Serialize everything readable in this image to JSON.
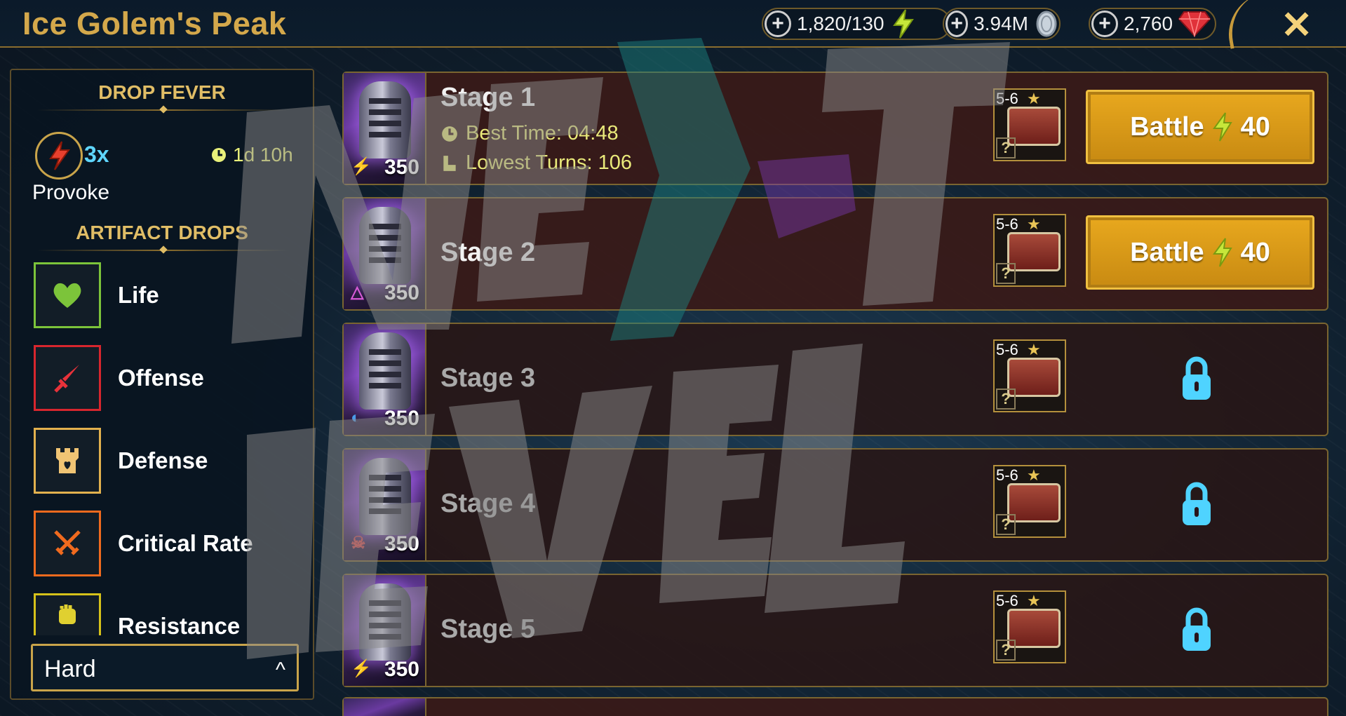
{
  "header": {
    "title": "Ice Golem's Peak",
    "energy": "1,820/130",
    "silver": "3.94M",
    "gems": "2,760"
  },
  "drop_fever": {
    "heading": "DROP FEVER",
    "multiplier": "3x",
    "timer": "1d 10h",
    "set_name": "Provoke"
  },
  "artifact_drops": {
    "heading": "ARTIFACT DROPS",
    "items": [
      {
        "label": "Life",
        "icon": "heart-icon",
        "color": "#7cc43a"
      },
      {
        "label": "Offense",
        "icon": "sword-icon",
        "color": "#d8262e"
      },
      {
        "label": "Defense",
        "icon": "tower-icon",
        "color": "#e2b14e"
      },
      {
        "label": "Critical Rate",
        "icon": "crossed-swords-icon",
        "color": "#f06a1e"
      },
      {
        "label": "Resistance",
        "icon": "fist-icon",
        "color": "#d6c21a"
      }
    ]
  },
  "difficulty": {
    "value": "Hard"
  },
  "stages": [
    {
      "name": "Stage 1",
      "power": "350",
      "reward_range": "5-6",
      "best_time_label": "Best Time: 04:48",
      "lowest_turns_label": "Lowest Turns: 106",
      "battle_label": "Battle",
      "battle_cost": "40",
      "locked": false,
      "affinity": "magic"
    },
    {
      "name": "Stage 2",
      "power": "350",
      "reward_range": "5-6",
      "battle_label": "Battle",
      "battle_cost": "40",
      "locked": false,
      "affinity": "void"
    },
    {
      "name": "Stage 3",
      "power": "350",
      "reward_range": "5-6",
      "locked": true,
      "affinity": "force"
    },
    {
      "name": "Stage 4",
      "power": "350",
      "reward_range": "5-6",
      "locked": true,
      "affinity": "spirit"
    },
    {
      "name": "Stage 5",
      "power": "350",
      "reward_range": "5-6",
      "locked": true,
      "affinity": "magic"
    }
  ],
  "colors": {
    "accent": "#d4a84b",
    "battle": "#e8a81e",
    "lock": "#4fd3ff",
    "timer": "#e9f07a"
  }
}
